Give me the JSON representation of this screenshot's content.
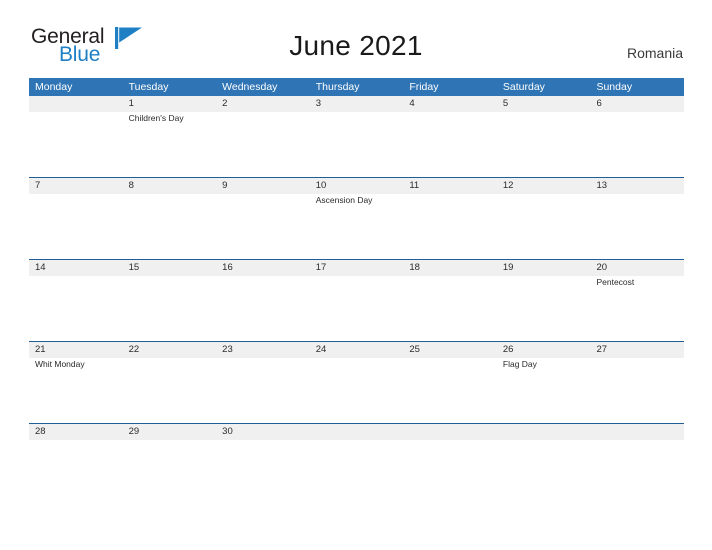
{
  "brand": {
    "name_part1": "General",
    "name_part2": "Blue",
    "flag_icon": "blue-triangle-flag-icon",
    "color_dark": "#231f20",
    "color_blue": "#1f7fc4"
  },
  "header": {
    "title": "June 2021",
    "country": "Romania"
  },
  "theme": {
    "header_blue": "#2f74b5",
    "row_divider_blue": "#215e96",
    "date_band_gray": "#f0f0f0",
    "event_bg": "#ffffff",
    "page_bg": "#ffffff"
  },
  "calendar": {
    "month": "June",
    "year": "2021",
    "weekdays": [
      "Monday",
      "Tuesday",
      "Wednesday",
      "Thursday",
      "Friday",
      "Saturday",
      "Sunday"
    ],
    "weeks": [
      {
        "days": [
          {
            "date": "",
            "event": ""
          },
          {
            "date": "1",
            "event": "Children's Day"
          },
          {
            "date": "2",
            "event": ""
          },
          {
            "date": "3",
            "event": ""
          },
          {
            "date": "4",
            "event": ""
          },
          {
            "date": "5",
            "event": ""
          },
          {
            "date": "6",
            "event": ""
          }
        ]
      },
      {
        "days": [
          {
            "date": "7",
            "event": ""
          },
          {
            "date": "8",
            "event": ""
          },
          {
            "date": "9",
            "event": ""
          },
          {
            "date": "10",
            "event": "Ascension Day"
          },
          {
            "date": "11",
            "event": ""
          },
          {
            "date": "12",
            "event": ""
          },
          {
            "date": "13",
            "event": ""
          }
        ]
      },
      {
        "days": [
          {
            "date": "14",
            "event": ""
          },
          {
            "date": "15",
            "event": ""
          },
          {
            "date": "16",
            "event": ""
          },
          {
            "date": "17",
            "event": ""
          },
          {
            "date": "18",
            "event": ""
          },
          {
            "date": "19",
            "event": ""
          },
          {
            "date": "20",
            "event": "Pentecost"
          }
        ]
      },
      {
        "days": [
          {
            "date": "21",
            "event": "Whit Monday"
          },
          {
            "date": "22",
            "event": ""
          },
          {
            "date": "23",
            "event": ""
          },
          {
            "date": "24",
            "event": ""
          },
          {
            "date": "25",
            "event": ""
          },
          {
            "date": "26",
            "event": "Flag Day"
          },
          {
            "date": "27",
            "event": ""
          }
        ]
      },
      {
        "days": [
          {
            "date": "28",
            "event": ""
          },
          {
            "date": "29",
            "event": ""
          },
          {
            "date": "30",
            "event": ""
          },
          {
            "date": "",
            "event": ""
          },
          {
            "date": "",
            "event": ""
          },
          {
            "date": "",
            "event": ""
          },
          {
            "date": "",
            "event": ""
          }
        ]
      }
    ]
  }
}
